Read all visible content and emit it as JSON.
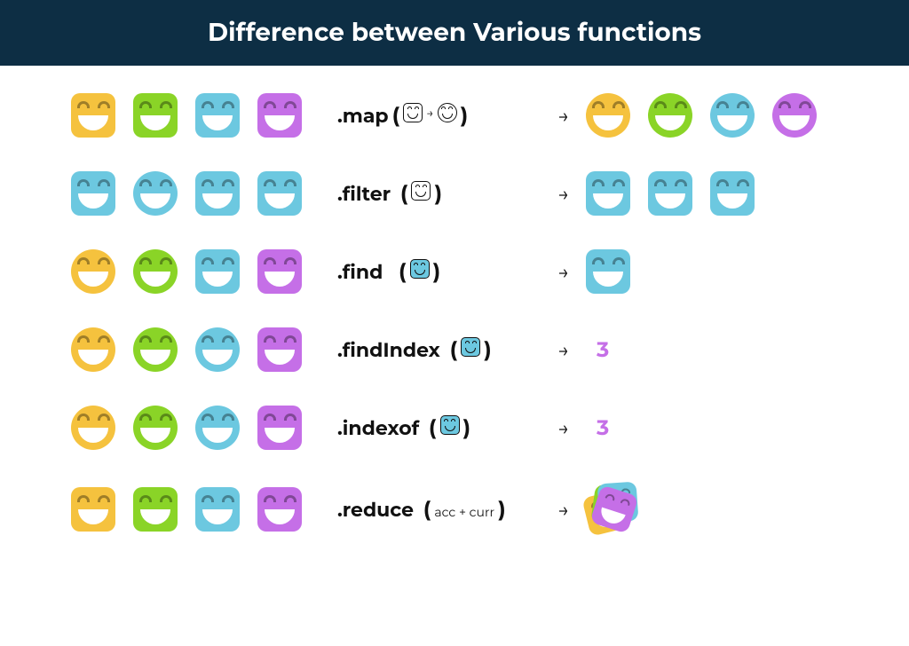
{
  "header": {
    "title": "Difference between Various functions"
  },
  "rows": {
    "map": {
      "name": ".map",
      "inner_sep": "→"
    },
    "filter": {
      "name": ".filter"
    },
    "find": {
      "name": ".find"
    },
    "findIndex": {
      "name": ".findIndex",
      "result": "3"
    },
    "indexof": {
      "name": ".indexof",
      "result": "3"
    },
    "reduce": {
      "name": ".reduce",
      "inner_text": "acc + curr"
    }
  },
  "arrow": "→",
  "colors": {
    "yellow": "#f5c23e",
    "green": "#8ad427",
    "blue": "#6cc8e0",
    "purple": "#c56fe7",
    "header_bg": "#0d2e44"
  },
  "shapes": [
    "square",
    "circle"
  ],
  "inputs": {
    "map": [
      [
        "yellow",
        "square"
      ],
      [
        "green",
        "square"
      ],
      [
        "blue",
        "square"
      ],
      [
        "purple",
        "square"
      ]
    ],
    "filter": [
      [
        "blue",
        "square"
      ],
      [
        "blue",
        "circle"
      ],
      [
        "blue",
        "square"
      ],
      [
        "blue",
        "square"
      ]
    ],
    "find": [
      [
        "yellow",
        "circle"
      ],
      [
        "green",
        "circle"
      ],
      [
        "blue",
        "square"
      ],
      [
        "purple",
        "square"
      ]
    ],
    "findIndex": [
      [
        "yellow",
        "circle"
      ],
      [
        "green",
        "circle"
      ],
      [
        "blue",
        "circle"
      ],
      [
        "purple",
        "square"
      ]
    ],
    "indexof": [
      [
        "yellow",
        "circle"
      ],
      [
        "green",
        "circle"
      ],
      [
        "blue",
        "circle"
      ],
      [
        "purple",
        "square"
      ]
    ],
    "reduce": [
      [
        "yellow",
        "square"
      ],
      [
        "green",
        "square"
      ],
      [
        "blue",
        "square"
      ],
      [
        "purple",
        "square"
      ]
    ]
  },
  "outputs": {
    "map": [
      [
        "yellow",
        "circle"
      ],
      [
        "green",
        "circle"
      ],
      [
        "blue",
        "circle"
      ],
      [
        "purple",
        "circle"
      ]
    ],
    "filter": [
      [
        "blue",
        "square"
      ],
      [
        "blue",
        "square"
      ],
      [
        "blue",
        "square"
      ]
    ],
    "find": [
      [
        "blue",
        "square"
      ]
    ]
  }
}
